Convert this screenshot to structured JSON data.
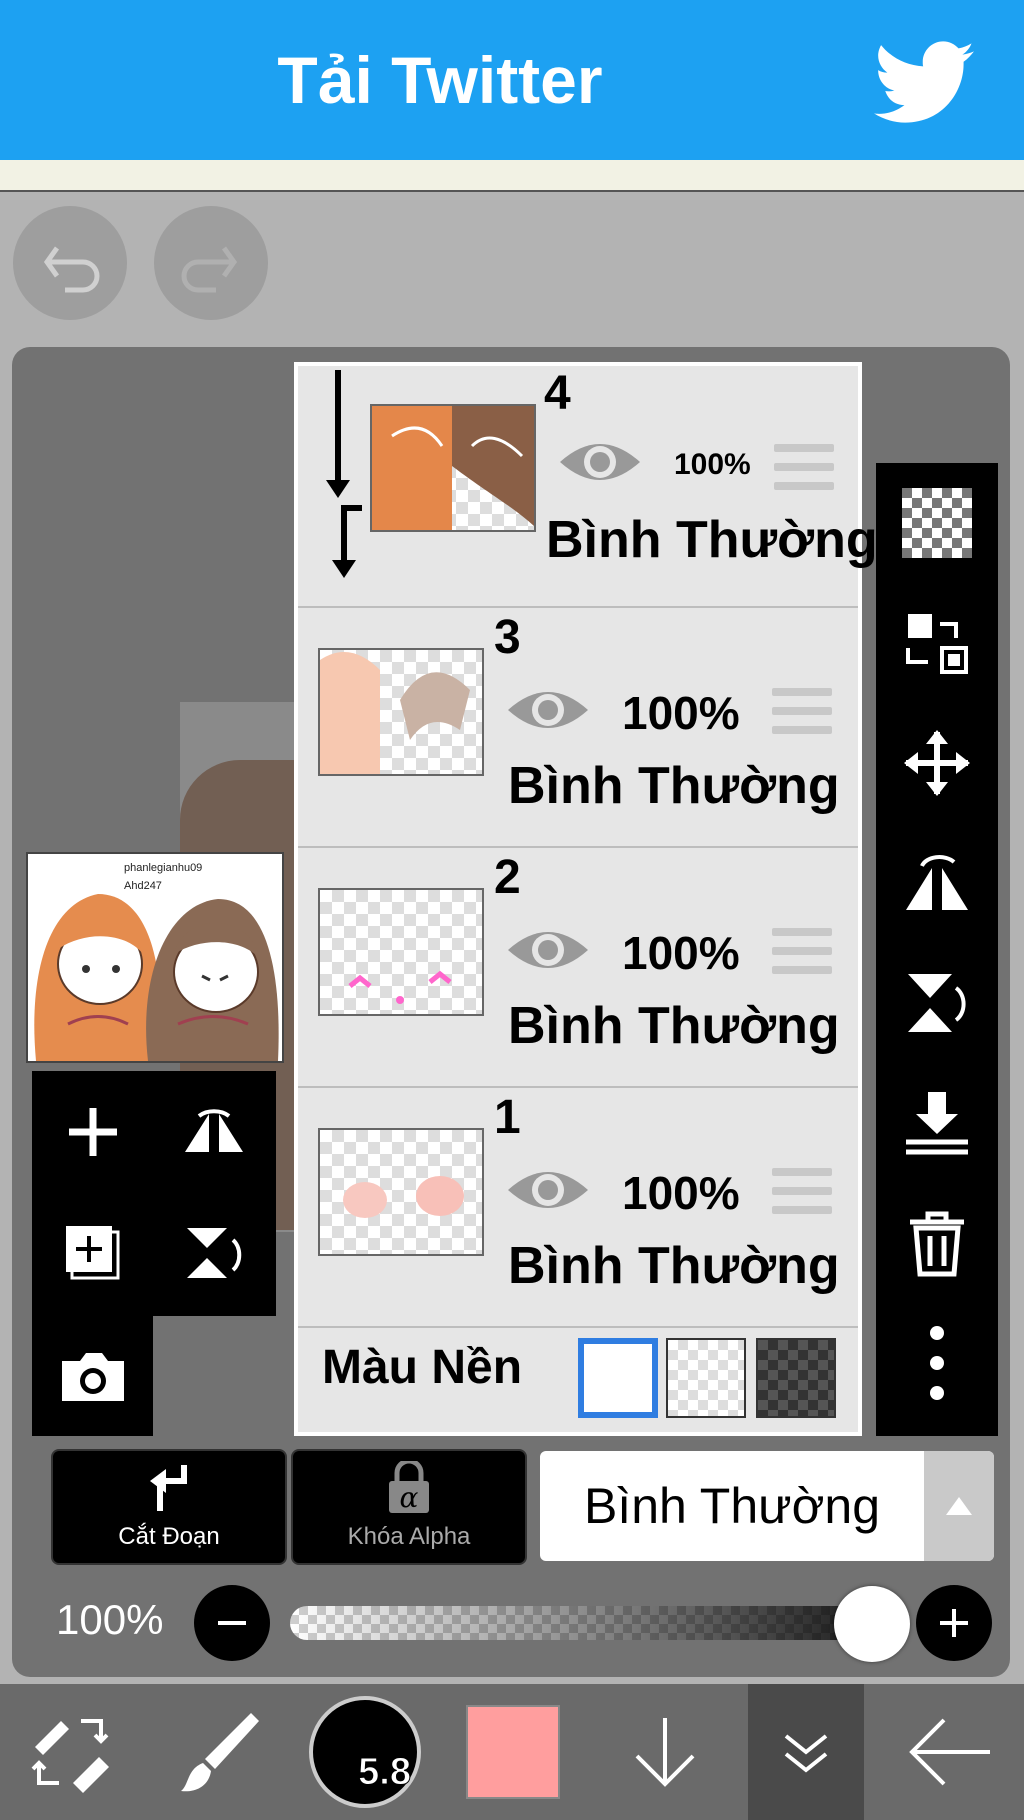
{
  "banner": {
    "title": "Tải Twitter",
    "color": "#1da1f2"
  },
  "history": {
    "undo_icon": "undo-icon",
    "redo_icon": "redo-icon"
  },
  "thumbnail": {
    "text_line1": "phanlegianhu09",
    "text_line2": "Ahd247"
  },
  "layers": [
    {
      "number": "4",
      "opacity": "100%",
      "mode": "Bình Thường"
    },
    {
      "number": "3",
      "opacity": "100%",
      "mode": "Bình Thường"
    },
    {
      "number": "2",
      "opacity": "100%",
      "mode": "Bình Thường"
    },
    {
      "number": "1",
      "opacity": "100%",
      "mode": "Bình Thường"
    }
  ],
  "background_color": {
    "label": "Màu Nền",
    "options": [
      "white",
      "transparent",
      "dark-checker"
    ],
    "selected": "white"
  },
  "controls": {
    "clip_label": "Cắt Đoạn",
    "alpha_lock_label": "Khóa Alpha",
    "blend_mode": "Bình Thường",
    "opacity_label": "100%",
    "opacity_value": 1.0
  },
  "toolbar": {
    "brush_size": "5.8",
    "current_color": "#ff9e9e"
  }
}
